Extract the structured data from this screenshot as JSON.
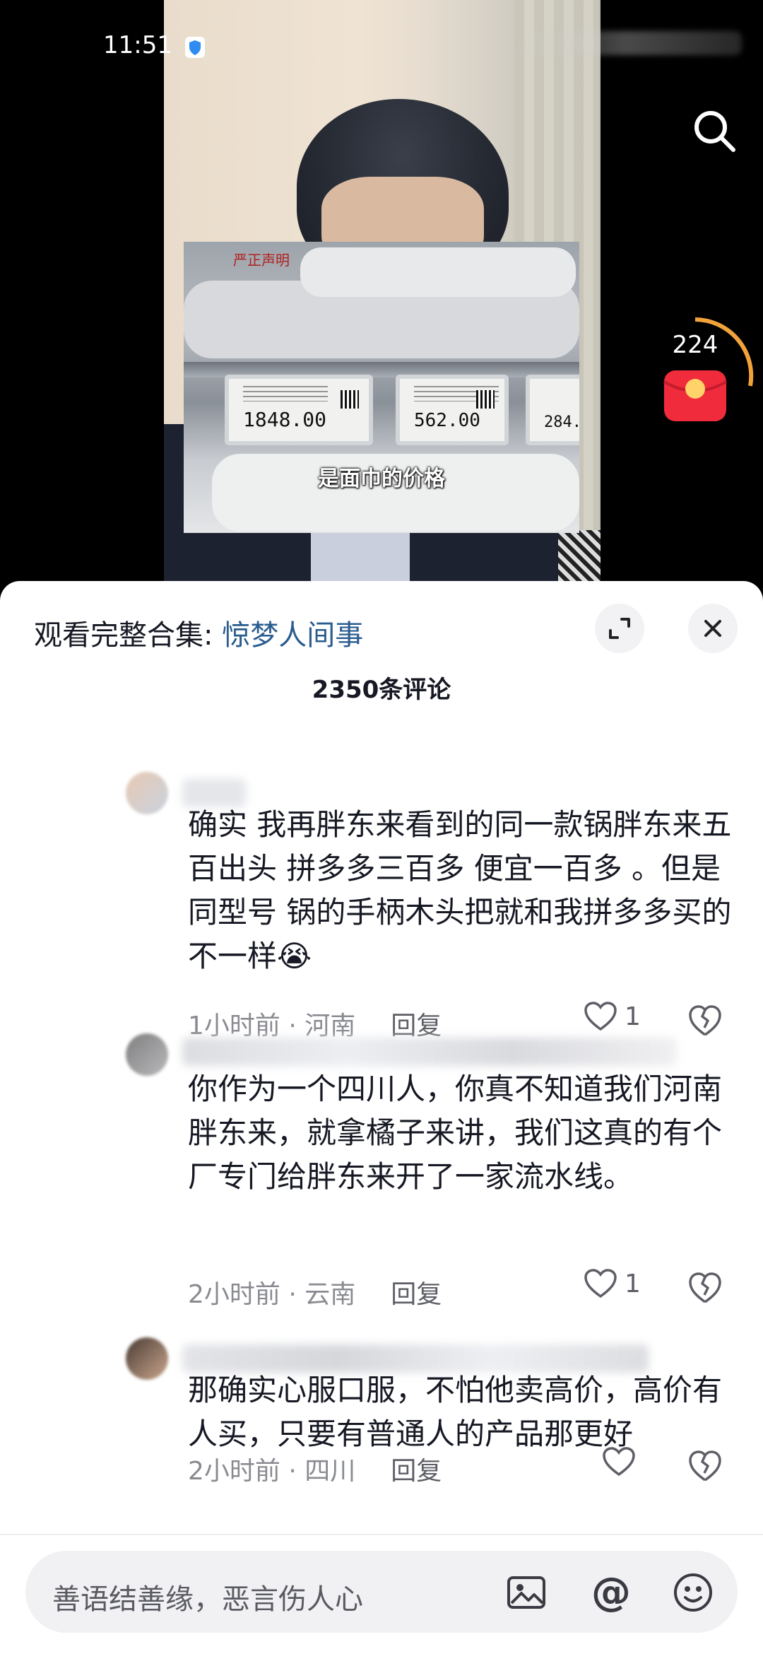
{
  "status_bar": {
    "time": "11:51"
  },
  "video": {
    "subtitle": "是面巾的价格",
    "inset_tag": "严正声明",
    "price_tags": [
      "1848.00",
      "562.00",
      "284."
    ],
    "red_packet_count": "224"
  },
  "sheet": {
    "collection_label": "观看完整合集: ",
    "collection_name": "惊梦人间事",
    "comment_count": "2350条评论",
    "comments": [
      {
        "text": "确实  我再胖东来看到的同一款锅胖东来五百出头  拼多多三百多 便宜一百多  。但是同型号 锅的手柄木头把就和我拼多多买的不一样😭",
        "time": "1小时前",
        "location": "河南",
        "reply": "回复",
        "likes": "1"
      },
      {
        "text": "你作为一个四川人，你真不知道我们河南胖东来，就拿橘子来讲，我们这真的有个厂专门给胖东来开了一家流水线。",
        "time": "2小时前",
        "location": "云南",
        "reply": "回复",
        "likes": "1"
      },
      {
        "text": "那确实心服口服，不怕他卖高价，高价有人买，只要有普通人的产品那更好",
        "time": "2小时前",
        "location": "四川",
        "reply": "回复",
        "likes": ""
      }
    ],
    "input_placeholder": "善语结善缘，恶言伤人心",
    "at_symbol": "@"
  },
  "icons": [
    "shield-icon",
    "search-icon",
    "red-packet-icon",
    "expand-icon",
    "close-icon",
    "heart-icon",
    "broken-heart-icon",
    "image-icon",
    "at-icon",
    "emoji-icon"
  ]
}
